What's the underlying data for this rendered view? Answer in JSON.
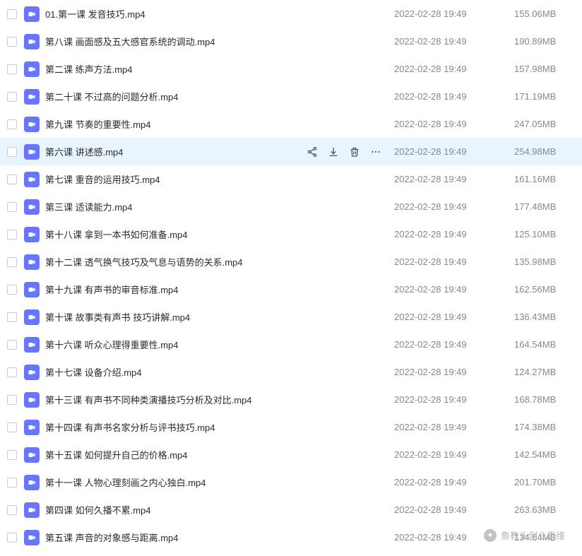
{
  "watermark": {
    "label": "鱼教头创业思维"
  },
  "hovered_index": 5,
  "files": [
    {
      "name": "01.第一课 发音技巧.mp4",
      "date": "2022-02-28 19:49",
      "size": "155.06MB"
    },
    {
      "name": "第八课 画面感及五大感官系统的调动.mp4",
      "date": "2022-02-28 19:49",
      "size": "190.89MB"
    },
    {
      "name": "第二课 练声方法.mp4",
      "date": "2022-02-28 19:49",
      "size": "157.98MB"
    },
    {
      "name": "第二十课 不过高的问题分析.mp4",
      "date": "2022-02-28 19:49",
      "size": "171.19MB"
    },
    {
      "name": "第九课 节奏的重要性.mp4",
      "date": "2022-02-28 19:49",
      "size": "247.05MB"
    },
    {
      "name": "第六课 讲述感.mp4",
      "date": "2022-02-28 19:49",
      "size": "254.98MB"
    },
    {
      "name": "第七课 重音的运用技巧.mp4",
      "date": "2022-02-28 19:49",
      "size": "161.16MB"
    },
    {
      "name": "第三课 适读能力.mp4",
      "date": "2022-02-28 19:49",
      "size": "177.48MB"
    },
    {
      "name": "第十八课 拿到一本书如何准备.mp4",
      "date": "2022-02-28 19:49",
      "size": "125.10MB"
    },
    {
      "name": "第十二课 透气换气技巧及气息与语势的关系.mp4",
      "date": "2022-02-28 19:49",
      "size": "135.98MB"
    },
    {
      "name": "第十九课 有声书的审音标准.mp4",
      "date": "2022-02-28 19:49",
      "size": "162.56MB"
    },
    {
      "name": "第十课 故事类有声书 技巧讲解.mp4",
      "date": "2022-02-28 19:49",
      "size": "136.43MB"
    },
    {
      "name": "第十六课 听众心理得重要性.mp4",
      "date": "2022-02-28 19:49",
      "size": "164.54MB"
    },
    {
      "name": "第十七课 设备介绍.mp4",
      "date": "2022-02-28 19:49",
      "size": "124.27MB"
    },
    {
      "name": "第十三课 有声书不同种类演播技巧分析及对比.mp4",
      "date": "2022-02-28 19:49",
      "size": "168.78MB"
    },
    {
      "name": "第十四课 有声书名家分析与评书技巧.mp4",
      "date": "2022-02-28 19:49",
      "size": "174.38MB"
    },
    {
      "name": "第十五课 如何提升自己的价格.mp4",
      "date": "2022-02-28 19:49",
      "size": "142.54MB"
    },
    {
      "name": "第十一课 人物心理刻画之内心独白.mp4",
      "date": "2022-02-28 19:49",
      "size": "201.70MB"
    },
    {
      "name": "第四课 如何久播不累.mp4",
      "date": "2022-02-28 19:49",
      "size": "263.63MB"
    },
    {
      "name": "第五课 声音的对象感与距离.mp4",
      "date": "2022-02-28 19:49",
      "size": "134.64MB"
    }
  ]
}
